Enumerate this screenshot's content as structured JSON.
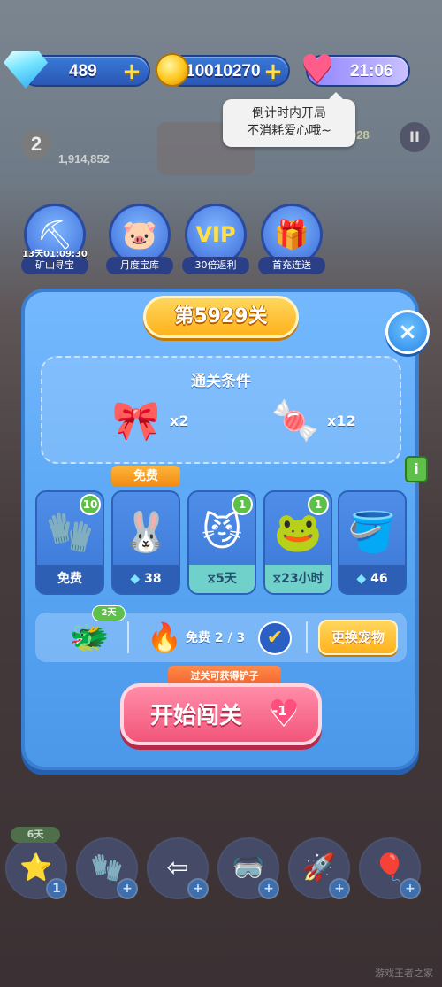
{
  "resources": {
    "gems": "489",
    "coins": "10010270",
    "hearts_timer": "21:06",
    "plus": "+"
  },
  "tooltip": {
    "line1": "倒计时内开局",
    "line2": "不消耗爱心哦~"
  },
  "background": {
    "player_level": "2",
    "score": "1,914,852",
    "coin_count": "928",
    "pause_symbol": "II"
  },
  "shortcuts": [
    {
      "label": "矿山寻宝",
      "timer": "13天01:09:30",
      "icon": "gem-pick-icon"
    },
    {
      "label": "月度宝库",
      "icon": "piggy-key-icon"
    },
    {
      "label": "30倍返利",
      "icon": "vip-icon"
    },
    {
      "label": "首充连送",
      "icon": "gift-box-icon"
    }
  ],
  "dialog": {
    "level_title": "第5929关",
    "close_symbol": "×",
    "side_flag": "i",
    "conditions": {
      "title": "通关条件",
      "goals": [
        {
          "icon": "bow-candy-icon",
          "count": "x2"
        },
        {
          "icon": "wrapped-candy-icon",
          "count": "x12"
        }
      ]
    },
    "free_tag": "免费",
    "boosters": [
      {
        "icon": "glove-x3-icon",
        "badge": "10",
        "footer": "免费",
        "timed": false
      },
      {
        "icon": "bunny-icon",
        "footer": "38",
        "cost_icon": "◆",
        "timed": false
      },
      {
        "icon": "cat-goggles-icon",
        "badge": "1",
        "footer": "5天",
        "cost_icon": "⧖",
        "timed": true
      },
      {
        "icon": "frog-icon",
        "badge": "1",
        "footer": "23小时",
        "cost_icon": "⧖",
        "timed": true
      },
      {
        "icon": "paint-bucket-icon",
        "footer": "46",
        "cost_icon": "◆",
        "timed": false
      }
    ],
    "pet": {
      "days": "2天",
      "free_text": "免费 2 / 3",
      "check": "✔",
      "swap_label": "更换宠物"
    },
    "reward_tip": "过关可获得铲子",
    "start": {
      "label": "开始闯关",
      "cost": "-1"
    }
  },
  "bottom": {
    "days_badge": "6天",
    "slots": [
      {
        "icon": "star-icon",
        "count": "1"
      },
      {
        "icon": "glove-icon",
        "count": "+"
      },
      {
        "icon": "arrow-icon",
        "count": "+"
      },
      {
        "icon": "goggles-icon",
        "count": "+"
      },
      {
        "icon": "rocket-icon",
        "count": "+"
      },
      {
        "icon": "balloon-icon",
        "count": "+"
      }
    ]
  },
  "watermark": "游戏王者之家"
}
